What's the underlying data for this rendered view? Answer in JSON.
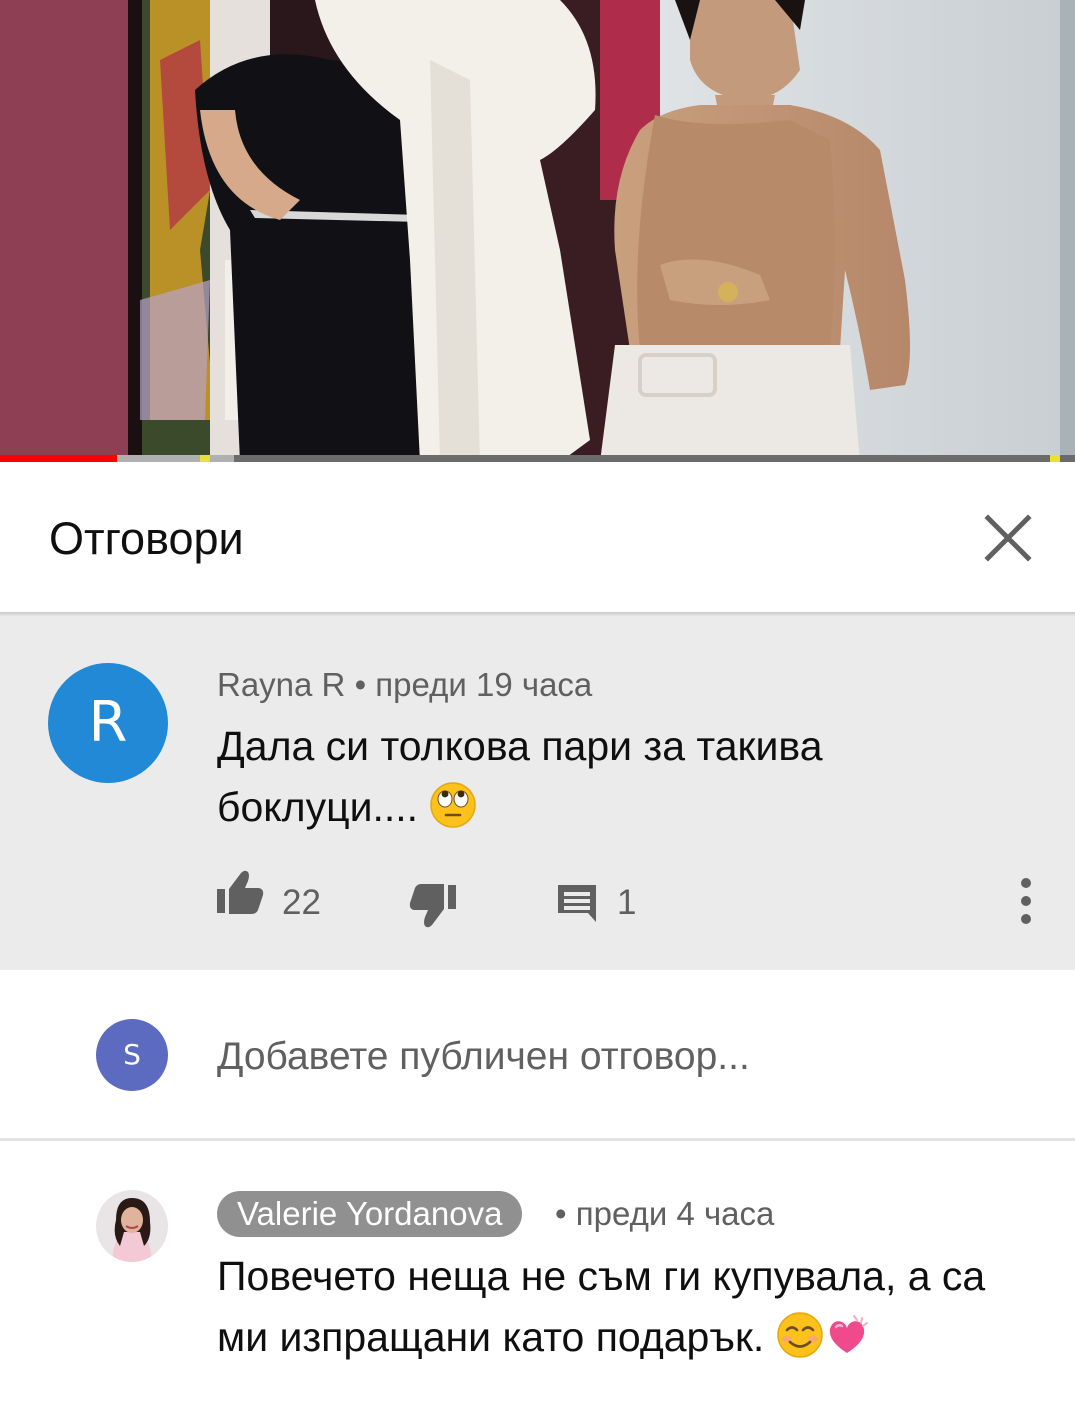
{
  "player": {
    "progress_fraction": 0.109,
    "buffered_fraction": 0.218,
    "colors": {
      "played": "#ff0000",
      "buffered": "#b0b0b0",
      "track": "#6b6b6b",
      "ad_marker": "#e8e234"
    }
  },
  "replies_panel": {
    "title": "Отговори",
    "close_icon": "close-icon"
  },
  "parent_comment": {
    "avatar_letter": "R",
    "avatar_color": "#2189d6",
    "author": "Rayna R",
    "separator": "•",
    "time": "преди 19 часа",
    "text": "Дала си толкова пари за такива боклуци....",
    "emoji": "face-with-rolling-eyes",
    "likes": "22",
    "replies": "1",
    "icons": [
      "thumbs-up-icon",
      "thumbs-down-icon",
      "reply-icon",
      "more-vert-icon"
    ]
  },
  "add_reply": {
    "avatar_letter": "S",
    "avatar_color": "#5c6bc0",
    "placeholder": "Добавете публичен отговор..."
  },
  "reply": {
    "author": "Valerie Yordanova",
    "separator": "•",
    "time": "преди 4 часа",
    "text": "Повечето неща не съм ги купувала, а са ми изпращани като подарък.",
    "emojis": [
      "smiling-face-icon",
      "beating-heart-icon"
    ]
  }
}
